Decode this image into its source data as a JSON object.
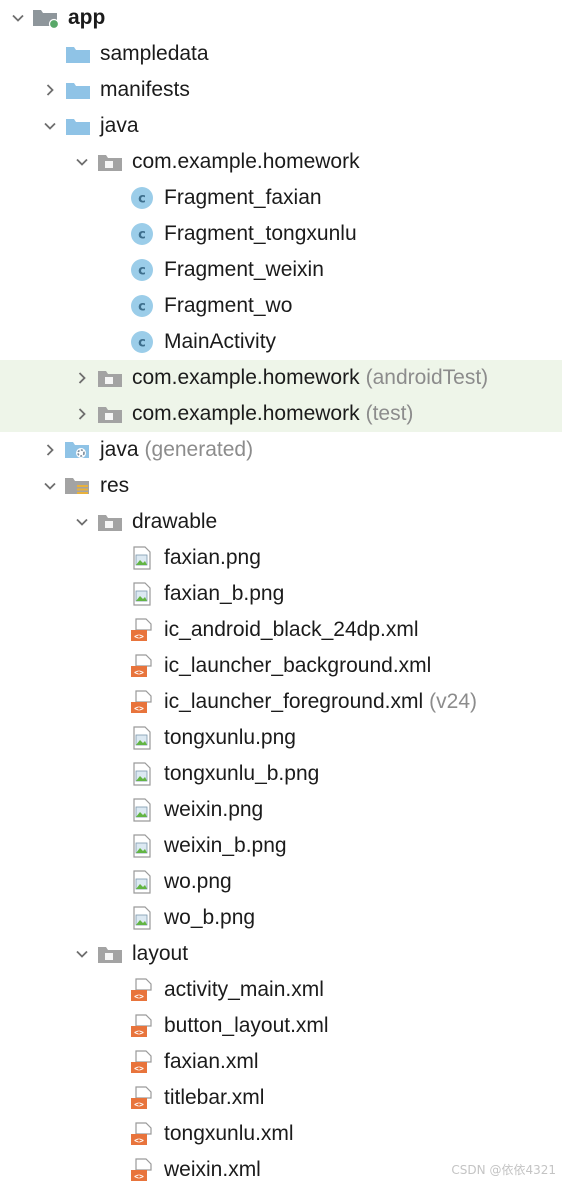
{
  "tree": {
    "app": {
      "label": "app",
      "expanded": true,
      "icon": "module-folder-icon"
    },
    "sampledata": {
      "label": "sampledata",
      "icon": "folder-icon"
    },
    "manifests": {
      "label": "manifests",
      "expanded": false,
      "icon": "folder-icon"
    },
    "java": {
      "label": "java",
      "expanded": true,
      "icon": "folder-icon"
    },
    "pkg_main": {
      "label": "com.example.homework",
      "expanded": true,
      "icon": "package-icon"
    },
    "classes": [
      {
        "label": "Fragment_faxian",
        "icon": "java-class-icon"
      },
      {
        "label": "Fragment_tongxunlu",
        "icon": "java-class-icon"
      },
      {
        "label": "Fragment_weixin",
        "icon": "java-class-icon"
      },
      {
        "label": "Fragment_wo",
        "icon": "java-class-icon"
      },
      {
        "label": "MainActivity",
        "icon": "java-class-icon"
      }
    ],
    "pkg_android_test": {
      "label": "com.example.homework",
      "suffix": "(androidTest)",
      "expanded": false,
      "icon": "package-icon"
    },
    "pkg_test": {
      "label": "com.example.homework",
      "suffix": "(test)",
      "expanded": false,
      "icon": "package-icon"
    },
    "java_generated": {
      "label": "java",
      "suffix": "(generated)",
      "expanded": false,
      "icon": "generated-folder-icon"
    },
    "res": {
      "label": "res",
      "expanded": true,
      "icon": "res-folder-icon"
    },
    "drawable": {
      "label": "drawable",
      "expanded": true,
      "icon": "package-icon"
    },
    "drawable_files": [
      {
        "label": "faxian.png",
        "icon": "image-file-icon"
      },
      {
        "label": "faxian_b.png",
        "icon": "image-file-icon"
      },
      {
        "label": "ic_android_black_24dp.xml",
        "icon": "xml-file-icon"
      },
      {
        "label": "ic_launcher_background.xml",
        "icon": "xml-file-icon"
      },
      {
        "label": "ic_launcher_foreground.xml",
        "suffix": "(v24)",
        "icon": "xml-file-icon"
      },
      {
        "label": "tongxunlu.png",
        "icon": "image-file-icon"
      },
      {
        "label": "tongxunlu_b.png",
        "icon": "image-file-icon"
      },
      {
        "label": "weixin.png",
        "icon": "image-file-icon"
      },
      {
        "label": "weixin_b.png",
        "icon": "image-file-icon"
      },
      {
        "label": "wo.png",
        "icon": "image-file-icon"
      },
      {
        "label": "wo_b.png",
        "icon": "image-file-icon"
      }
    ],
    "layout": {
      "label": "layout",
      "expanded": true,
      "icon": "package-icon"
    },
    "layout_files": [
      {
        "label": "activity_main.xml",
        "icon": "xml-file-icon"
      },
      {
        "label": "button_layout.xml",
        "icon": "xml-file-icon"
      },
      {
        "label": "faxian.xml",
        "icon": "xml-file-icon"
      },
      {
        "label": "titlebar.xml",
        "icon": "xml-file-icon"
      },
      {
        "label": "tongxunlu.xml",
        "icon": "xml-file-icon"
      },
      {
        "label": "weixin.xml",
        "icon": "xml-file-icon"
      }
    ]
  },
  "watermark": "CSDN @依依4321",
  "colors": {
    "folder": "#8fc3e6",
    "package_folder": "#a3a3a3",
    "class_circle": "#9bcde9",
    "class_letter": "#3d6e8c",
    "xml_orange": "#e8743c",
    "image_green": "#62b543",
    "module_dot": "#59a869",
    "highlight_row": "#eef5e9",
    "suffix_text": "#8c8c8c"
  }
}
